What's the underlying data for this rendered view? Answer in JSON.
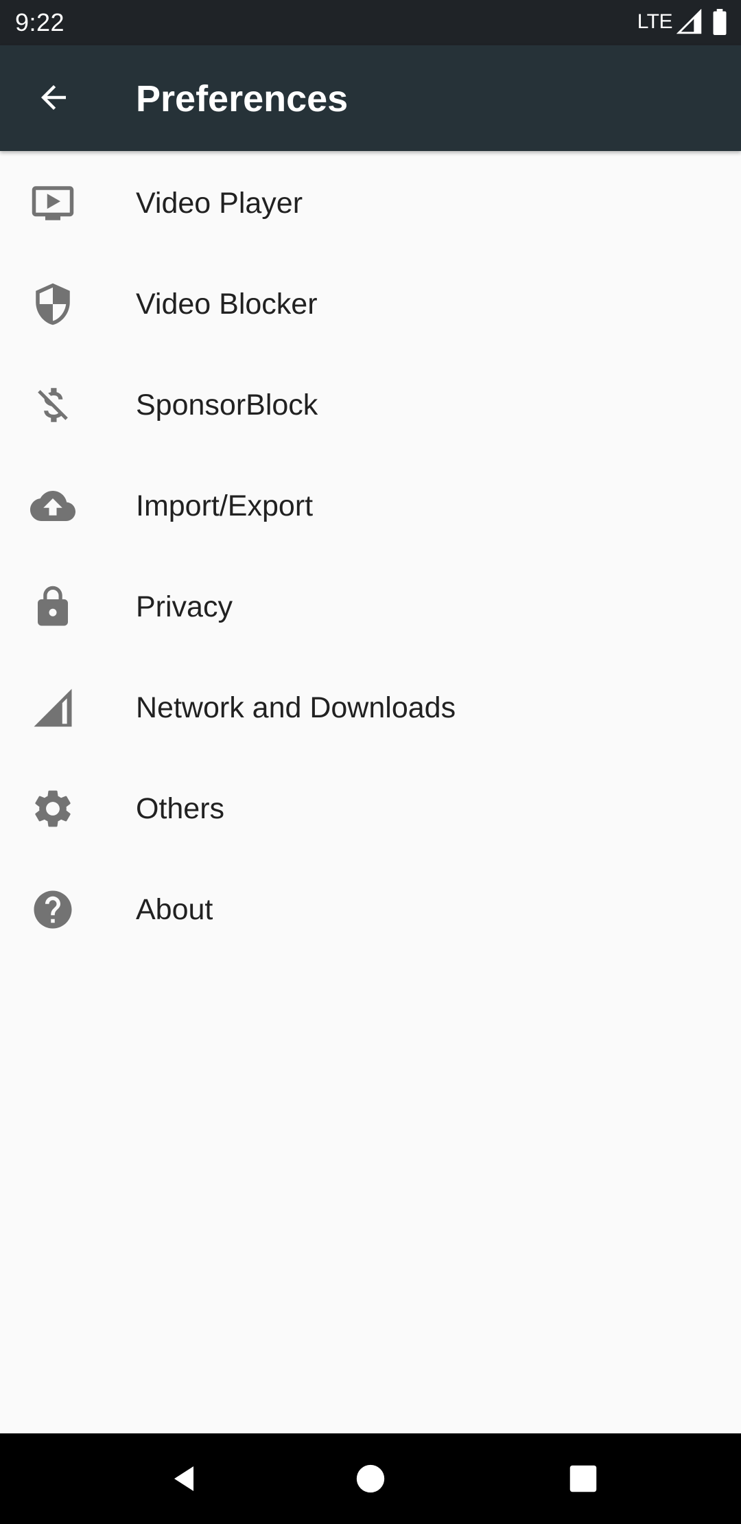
{
  "status_bar": {
    "time": "9:22",
    "network": "LTE",
    "icons": [
      "signal-icon",
      "battery-icon"
    ]
  },
  "app_bar": {
    "title": "Preferences",
    "back_icon": "arrow-back-icon"
  },
  "preferences": [
    {
      "label": "Video Player",
      "icon": "video-player-icon"
    },
    {
      "label": "Video Blocker",
      "icon": "shield-icon"
    },
    {
      "label": "SponsorBlock",
      "icon": "money-off-icon"
    },
    {
      "label": "Import/Export",
      "icon": "cloud-upload-icon"
    },
    {
      "label": "Privacy",
      "icon": "lock-icon"
    },
    {
      "label": "Network and Downloads",
      "icon": "signal-icon"
    },
    {
      "label": "Others",
      "icon": "gear-icon"
    },
    {
      "label": "About",
      "icon": "help-icon"
    }
  ],
  "nav_bar": {
    "icons": [
      "nav-back-icon",
      "nav-home-icon",
      "nav-recents-icon"
    ]
  },
  "colors": {
    "status_bar": "#1F2327",
    "app_bar": "#263238",
    "background": "#FAFAFA",
    "icon": "#737373",
    "text": "#212121",
    "nav_bar": "#000000"
  }
}
